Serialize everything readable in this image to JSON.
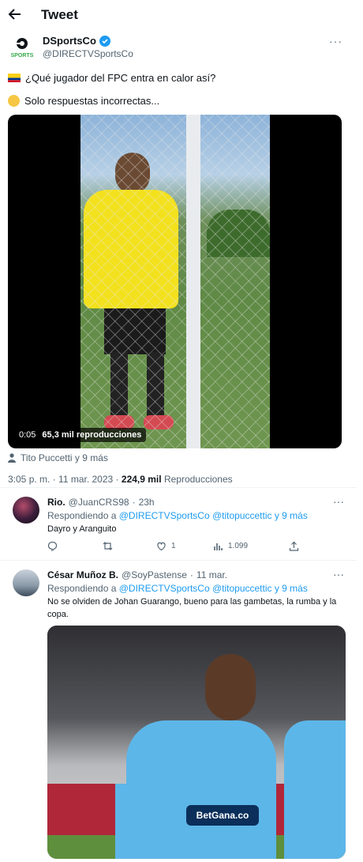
{
  "header": {
    "title": "Tweet"
  },
  "author": {
    "name": "DSportsCo",
    "handle": "@DIRECTVSportsCo",
    "logo_text": "SPORTS"
  },
  "tweet": {
    "line1": "¿Qué jugador del FPC entra en calor así?",
    "line2": "Solo respuestas incorrectas...",
    "video": {
      "time": "0:05",
      "views": "65,3 mil reproducciones"
    },
    "tagged": "Tito Puccetti y 9 más",
    "meta": {
      "time": "3:05 p. m.",
      "date": "11 mar. 2023",
      "views_count": "224,9 mil",
      "views_label": "Reproducciones"
    }
  },
  "replies": [
    {
      "name": "Rio.",
      "handle": "@JuanCRS98",
      "time": "23h",
      "replying_prefix": "Respondiendo a",
      "replying_to": "@DIRECTVSportsCo @titopuccettic y 9 más",
      "text": "Dayro y  Aranguito",
      "likes": "1",
      "views": "1.099"
    },
    {
      "name": "César Muñoz B.",
      "handle": "@SoyPastense",
      "time": "11 mar.",
      "replying_prefix": "Respondiendo a",
      "replying_to": "@DIRECTVSportsCo @titopuccettic y 9 más",
      "text": "No se olviden de Johan Guarango, bueno para las gambetas, la rumba y la copa.",
      "image_sponsor": "BetGana.co"
    }
  ],
  "colors": {
    "link": "#1d9bf0",
    "muted": "#536471",
    "text": "#0f1419"
  }
}
